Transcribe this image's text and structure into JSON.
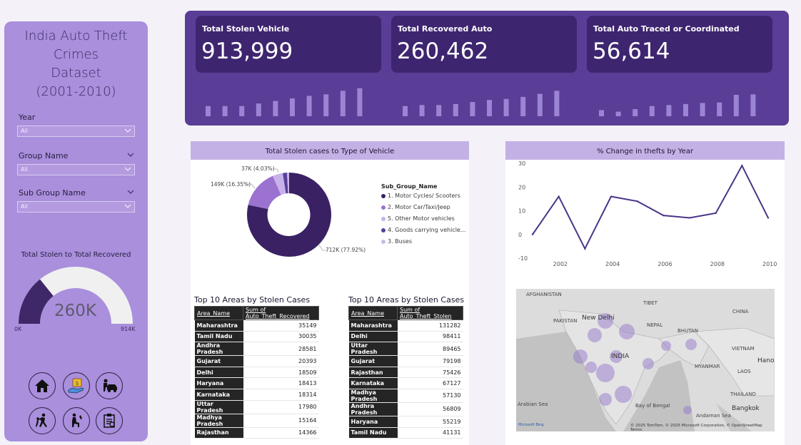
{
  "sidebar": {
    "title_lines": [
      "India Auto Theft Crimes",
      "Dataset",
      "(2001-2010)"
    ],
    "slicers": [
      {
        "label": "Year",
        "value": "All"
      },
      {
        "label": "Group Name",
        "value": "All"
      },
      {
        "label": "Sub Group Name",
        "value": "All"
      }
    ],
    "gauge": {
      "title": "Total Stolen to Total Recovered",
      "value_label": "260K",
      "min_label": "0K",
      "max_label": "914K",
      "value": 260462,
      "max": 913999
    },
    "nav_icons": [
      "home-icon",
      "money-hand-icon",
      "car-theft-icon",
      "running-thief-icon",
      "kneeling-person-icon",
      "document-list-icon"
    ]
  },
  "kpis": [
    {
      "label": "Total Stolen Vehicle",
      "value": "913,999",
      "spark": [
        2,
        2,
        2,
        2.5,
        3,
        3.5,
        4,
        4.3,
        5,
        5.5
      ]
    },
    {
      "label": "Total Recovered Auto",
      "value": "260,462",
      "spark": [
        2,
        2.2,
        2.2,
        2.4,
        2.8,
        3.2,
        3.4,
        3.8,
        4.4,
        5
      ]
    },
    {
      "label": "Total Auto Traced or Coordinated",
      "value": "56,614",
      "spark": [
        1.2,
        0.9,
        1.4,
        2,
        2.2,
        2.4,
        2.6,
        2.7,
        4.2,
        4.3
      ]
    }
  ],
  "colors": {
    "sidebar": "#a98fdc",
    "banner": "#5a3d96",
    "card": "#3e2570",
    "panel_head": "#c3b1e6",
    "line": "#4b3488"
  },
  "donut": {
    "title": "Total Stolen cases to Type of Vehicle",
    "legend_title": "Sub_Group_Name",
    "labels": {
      "big": "712K (77.92%)",
      "mid": "149K (16.35%)",
      "small": "37K (4.03%)"
    },
    "legend": [
      {
        "name": "1. Motor Cycles/ Scooters",
        "color": "#3a2163"
      },
      {
        "name": "2. Motor Car/Taxi/Jeep",
        "color": "#9b72cf"
      },
      {
        "name": "5. Other Motor vehicles",
        "color": "#c7b2ea"
      },
      {
        "name": "4. Goods carrying vehicle...",
        "color": "#57409a"
      },
      {
        "name": "3. Buses",
        "color": "#c9b8e8"
      }
    ]
  },
  "chart_data": {
    "type": "line",
    "title": "% Change in thefts by Year",
    "x": [
      2001,
      2002,
      2003,
      2004,
      2005,
      2006,
      2007,
      2008,
      2009,
      2010
    ],
    "values": [
      0,
      16,
      -6,
      16,
      14,
      8,
      7,
      9,
      29,
      7
    ],
    "x_ticks": [
      "2002",
      "2004",
      "2006",
      "2008",
      "2010"
    ],
    "y_ticks": [
      "30",
      "20",
      "10",
      "0",
      "-10"
    ],
    "ylim": [
      -10,
      30
    ]
  },
  "table_recovered": {
    "title": "Top 10 Areas by Stolen Cases",
    "columns": [
      "Area_Name",
      "Sum of Auto_Theft_Recovered"
    ],
    "rows": [
      [
        "Maharashtra",
        "35149"
      ],
      [
        "Tamil Nadu",
        "30035"
      ],
      [
        "Andhra Pradesh",
        "28581"
      ],
      [
        "Gujarat",
        "20393"
      ],
      [
        "Delhi",
        "18509"
      ],
      [
        "Haryana",
        "18413"
      ],
      [
        "Karnataka",
        "18314"
      ],
      [
        "Uttar Pradesh",
        "17980"
      ],
      [
        "Madhya Pradesh",
        "15164"
      ],
      [
        "Rajasthan",
        "14366"
      ]
    ]
  },
  "table_stolen": {
    "title": "Top 10 Areas by Stolen Cases",
    "columns": [
      "Area_Name",
      "Sum of Auto_Theft_Stolen"
    ],
    "rows": [
      [
        "Maharashtra",
        "131282"
      ],
      [
        "Delhi",
        "98411"
      ],
      [
        "Uttar Pradesh",
        "89465"
      ],
      [
        "Gujarat",
        "79198"
      ],
      [
        "Rajasthan",
        "75426"
      ],
      [
        "Karnataka",
        "67127"
      ],
      [
        "Madhya Pradesh",
        "57130"
      ],
      [
        "Andhra Pradesh",
        "56809"
      ],
      [
        "Haryana",
        "55219"
      ],
      [
        "Tamil Nadu",
        "41131"
      ]
    ]
  },
  "map": {
    "labels": [
      "AFGHANISTAN",
      "TIBET",
      "PAKISTAN",
      "New Delhi",
      "NEPAL",
      "BHUTAN",
      "CHINA",
      "INDIA",
      "MYANMAR",
      "LAOS",
      "VIETNAM",
      "THAILAND",
      "Bangkok",
      "Arabian Sea",
      "Bay of Bengal",
      "Andaman Sea",
      "Hanoi"
    ],
    "attribution": "© 2025 TomTom, © 2025 Microsoft Corporation, © OpenStreetMap  Terms",
    "brand": "Microsoft Bing"
  }
}
